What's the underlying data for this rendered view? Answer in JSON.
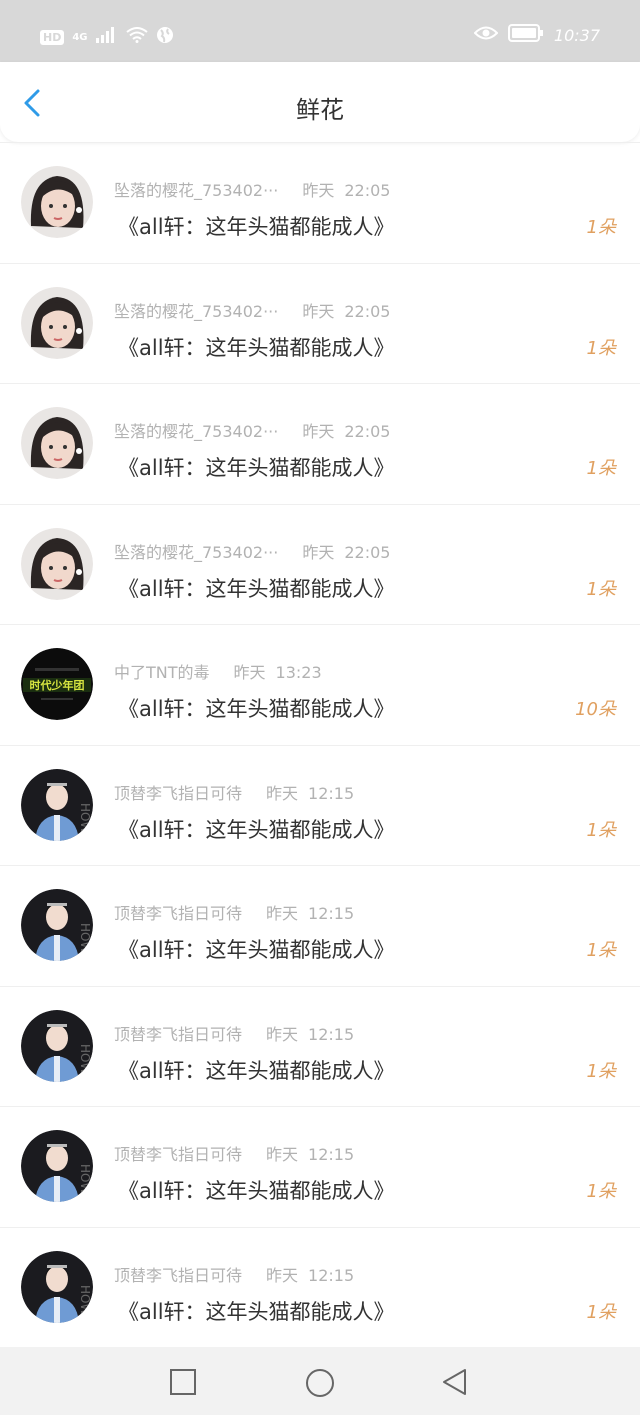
{
  "status": {
    "hd": "HD",
    "network": "4G",
    "time": "10:37"
  },
  "header": {
    "title": "鲜花"
  },
  "items": [
    {
      "user": "坠落的樱花_753402···",
      "day": "昨天",
      "time": "22:05",
      "book": "《all轩：这年头猫都能成人》",
      "count": "1朵",
      "avatar": "girl"
    },
    {
      "user": "坠落的樱花_753402···",
      "day": "昨天",
      "time": "22:05",
      "book": "《all轩：这年头猫都能成人》",
      "count": "1朵",
      "avatar": "girl"
    },
    {
      "user": "坠落的樱花_753402···",
      "day": "昨天",
      "time": "22:05",
      "book": "《all轩：这年头猫都能成人》",
      "count": "1朵",
      "avatar": "girl"
    },
    {
      "user": "坠落的樱花_753402···",
      "day": "昨天",
      "time": "22:05",
      "book": "《all轩：这年头猫都能成人》",
      "count": "1朵",
      "avatar": "girl"
    },
    {
      "user": "中了TNT的毒",
      "day": "昨天",
      "time": "13:23",
      "book": "《all轩：这年头猫都能成人》",
      "count": "10朵",
      "avatar": "dark"
    },
    {
      "user": "顶替李飞指日可待",
      "day": "昨天",
      "time": "12:15",
      "book": "《all轩：这年头猫都能成人》",
      "count": "1朵",
      "avatar": "boy"
    },
    {
      "user": "顶替李飞指日可待",
      "day": "昨天",
      "time": "12:15",
      "book": "《all轩：这年头猫都能成人》",
      "count": "1朵",
      "avatar": "boy"
    },
    {
      "user": "顶替李飞指日可待",
      "day": "昨天",
      "time": "12:15",
      "book": "《all轩：这年头猫都能成人》",
      "count": "1朵",
      "avatar": "boy"
    },
    {
      "user": "顶替李飞指日可待",
      "day": "昨天",
      "time": "12:15",
      "book": "《all轩：这年头猫都能成人》",
      "count": "1朵",
      "avatar": "boy"
    },
    {
      "user": "顶替李飞指日可待",
      "day": "昨天",
      "time": "12:15",
      "book": "《all轩：这年头猫都能成人》",
      "count": "1朵",
      "avatar": "boy"
    }
  ],
  "colors": {
    "accent": "#2f9be8",
    "count": "#e0a060",
    "meta": "#b2b2b2"
  }
}
